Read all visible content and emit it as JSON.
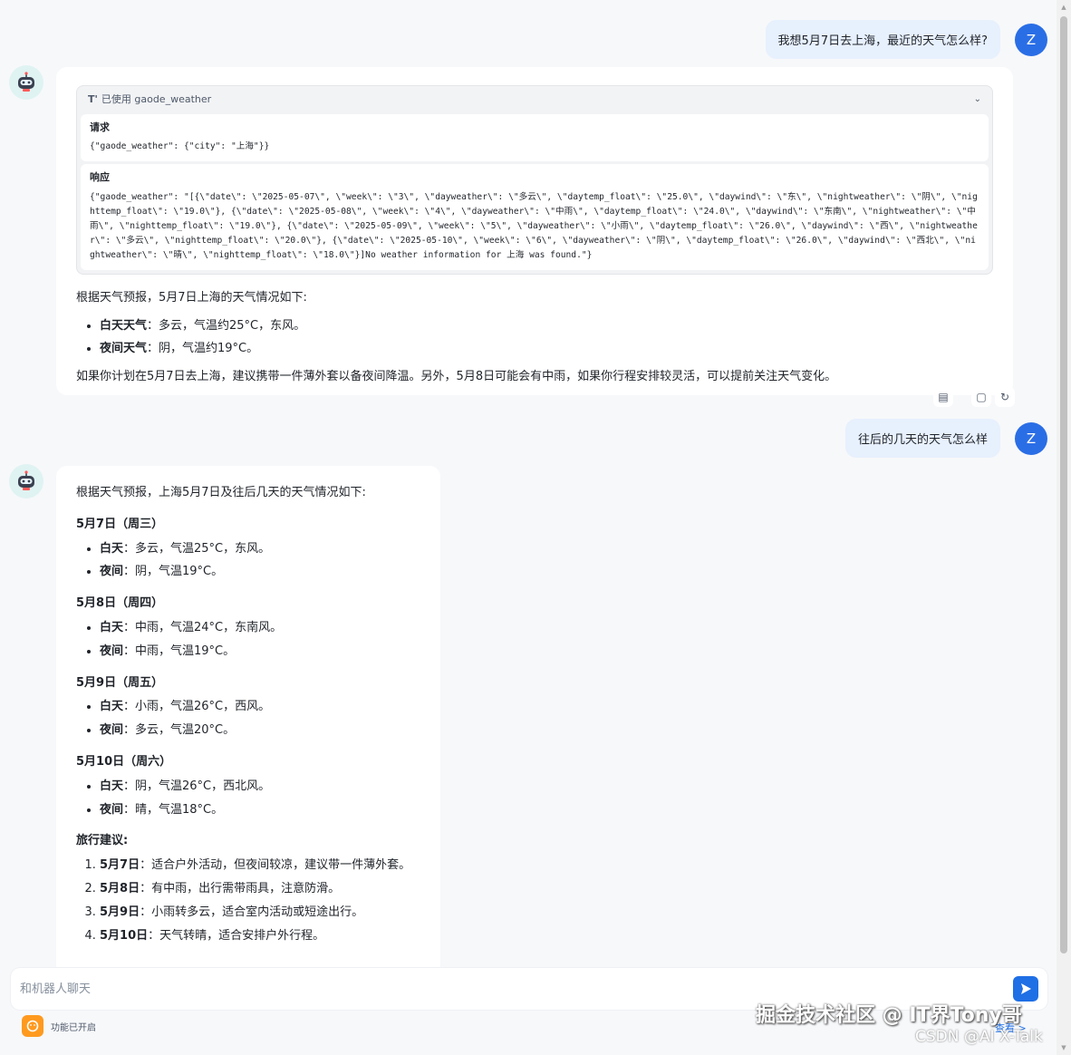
{
  "messages": {
    "user1": {
      "avatar": "Z",
      "text": "我想5月7日去上海，最近的天气怎么样?"
    },
    "bot1": {
      "tool": {
        "title": "已使用 gaode_weather",
        "request_label": "请求",
        "request_body": "{\"gaode_weather\": {\"city\": \"上海\"}}",
        "response_label": "响应",
        "response_body": "{\"gaode_weather\": \"[{\\\"date\\\": \\\"2025-05-07\\\", \\\"week\\\": \\\"3\\\", \\\"dayweather\\\": \\\"多云\\\", \\\"daytemp_float\\\": \\\"25.0\\\", \\\"daywind\\\": \\\"东\\\", \\\"nightweather\\\": \\\"阴\\\", \\\"nighttemp_float\\\": \\\"19.0\\\"}, {\\\"date\\\": \\\"2025-05-08\\\", \\\"week\\\": \\\"4\\\", \\\"dayweather\\\": \\\"中雨\\\", \\\"daytemp_float\\\": \\\"24.0\\\", \\\"daywind\\\": \\\"东南\\\", \\\"nightweather\\\": \\\"中雨\\\", \\\"nighttemp_float\\\": \\\"19.0\\\"}, {\\\"date\\\": \\\"2025-05-09\\\", \\\"week\\\": \\\"5\\\", \\\"dayweather\\\": \\\"小雨\\\", \\\"daytemp_float\\\": \\\"26.0\\\", \\\"daywind\\\": \\\"西\\\", \\\"nightweather\\\": \\\"多云\\\", \\\"nighttemp_float\\\": \\\"20.0\\\"}, {\\\"date\\\": \\\"2025-05-10\\\", \\\"week\\\": \\\"6\\\", \\\"dayweather\\\": \\\"阴\\\", \\\"daytemp_float\\\": \\\"26.0\\\", \\\"daywind\\\": \\\"西北\\\", \\\"nightweather\\\": \\\"晴\\\", \\\"nighttemp_float\\\": \\\"18.0\\\"}]No weather information for 上海 was found.\"}"
      },
      "intro": "根据天气预报，5月7日上海的天气情况如下:",
      "items": [
        {
          "label": "白天天气",
          "text": "：多云，气温约25°C，东风。"
        },
        {
          "label": "夜间天气",
          "text": "：阴，气温约19°C。"
        }
      ],
      "advice": "如果你计划在5月7日去上海，建议携带一件薄外套以备夜间降温。另外，5月8日可能会有中雨，如果你行程安排较灵活，可以提前关注天气变化。"
    },
    "user2": {
      "avatar": "Z",
      "text": "往后的几天的天气怎么样"
    },
    "bot2": {
      "intro": "根据天气预报，上海5月7日及往后几天的天气情况如下:",
      "days": [
        {
          "title": "5月7日（周三）",
          "day": "：多云，气温25°C，东风。",
          "night": "：阴，气温19°C。"
        },
        {
          "title": "5月8日（周四）",
          "day": "：中雨，气温24°C，东南风。",
          "night": "：中雨，气温19°C。"
        },
        {
          "title": "5月9日（周五）",
          "day": "：小雨，气温26°C，西风。",
          "night": "：多云，气温20°C。"
        },
        {
          "title": "5月10日（周六）",
          "day": "：阴，气温26°C，西北风。",
          "night": "：晴，气温18°C。"
        }
      ],
      "day_label": "白天",
      "night_label": "夜间",
      "tips_title": "旅行建议:",
      "tips": [
        {
          "label": "5月7日",
          "text": "：适合户外活动，但夜间较凉，建议带一件薄外套。"
        },
        {
          "label": "5月8日",
          "text": "：有中雨，出行需带雨具，注意防滑。"
        },
        {
          "label": "5月9日",
          "text": "：小雨转多云，适合室内活动或短途出行。"
        },
        {
          "label": "5月10日",
          "text": "：天气转晴，适合安排户外行程。"
        }
      ]
    }
  },
  "input": {
    "placeholder": "和机器人聊天"
  },
  "bottom": {
    "func_label": "功能已开启",
    "link_hint": "查看 >"
  },
  "watermark": {
    "line1": "掘金技术社区 @ IT界Tony哥",
    "line2": "CSDN @AI X-Talk"
  },
  "colors": {
    "accent": "#1f6fe5",
    "user_bubble": "#e7f0fd",
    "avatar": "#2a6ee6"
  }
}
